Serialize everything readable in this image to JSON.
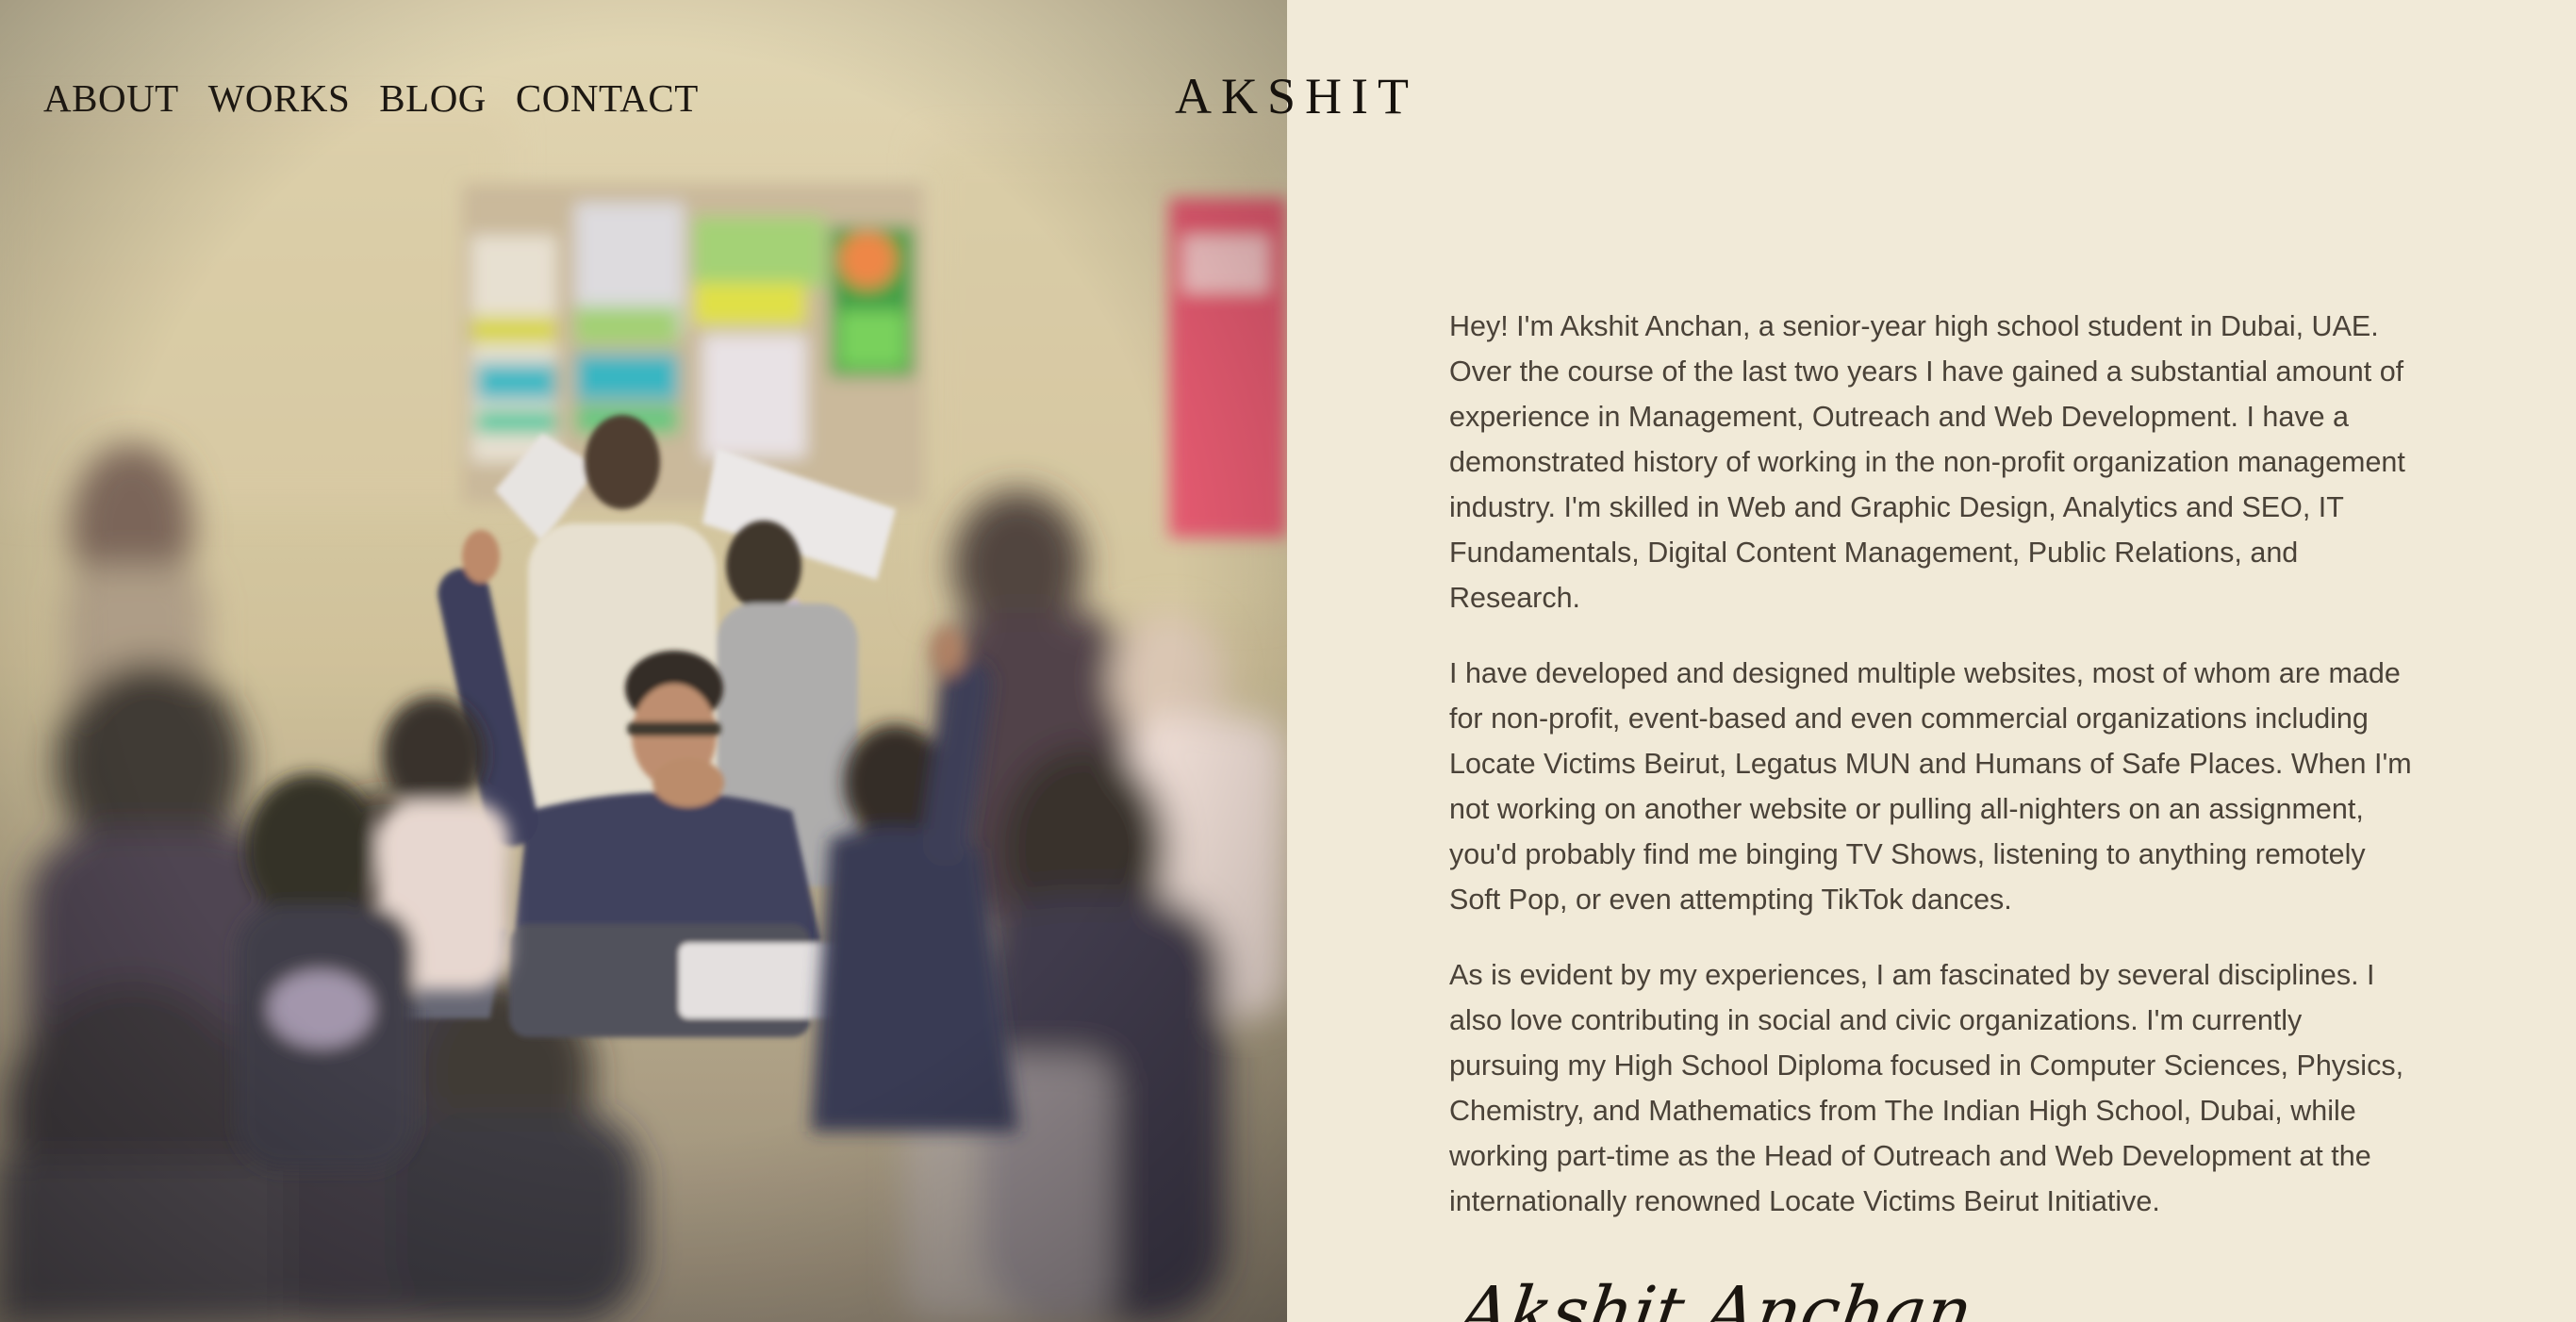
{
  "nav": {
    "items": [
      "ABOUT",
      "WORKS",
      "BLOG",
      "CONTACT"
    ]
  },
  "brand": {
    "name": "AKSHIT"
  },
  "bio": {
    "paragraphs": [
      "Hey! I'm Akshit Anchan, a senior-year high school student in Dubai, UAE. Over the course of the last two years I have gained a substantial amount of experience in Management, Outreach and Web Development. I have a demonstrated history of working in the non-profit organization management industry. I'm skilled in Web and Graphic Design, Analytics and SEO, IT Fundamentals, Digital Content Management, Public Relations, and Research.",
      "I have developed and designed multiple websites, most of whom are made for non-profit, event-based and even commercial organizations including Locate Victims Beirut, Legatus MUN and Humans of Safe Places. When I'm not working on another website or pulling all-nighters on an assignment, you'd probably find me binging TV Shows, listening to anything remotely Soft Pop, or even attempting TikTok dances.",
      "As is evident by my experiences, I am fascinated by several disciplines. I also love contributing in social and civic organizations. I'm currently pursuing my High School Diploma focused in Computer Sciences, Physics, Chemistry, and Mathematics from The Indian High School, Dubai, while working part-time as the Head of Outreach and Web Development at the internationally renowned Locate Victims Beirut Initiative."
    ]
  },
  "signature": {
    "text": "Akshit Anchan"
  },
  "colors": {
    "background": "#f1ead8",
    "text": "#4a4238",
    "nav_text": "#1d1812"
  }
}
